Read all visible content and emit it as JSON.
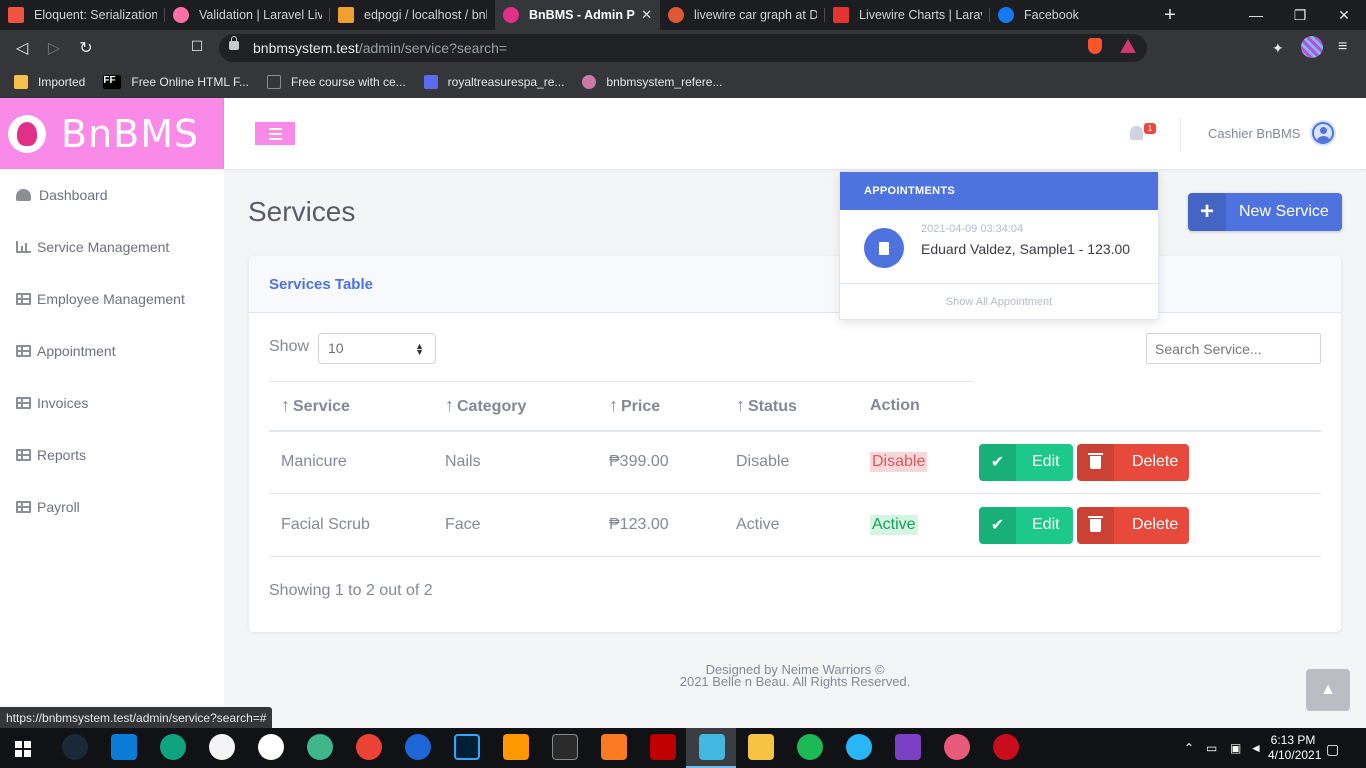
{
  "browser": {
    "tabs": [
      {
        "title": "Eloquent: Serialization -",
        "icon": "laravel-icon",
        "color": "#f05340",
        "active": false
      },
      {
        "title": "Validation | Laravel Livev",
        "icon": "livewire-icon",
        "color": "#fb70a9",
        "active": false
      },
      {
        "title": "edpogi / localhost / bnb",
        "icon": "phpmyadmin-icon",
        "color": "#f0a030",
        "active": false
      },
      {
        "title": "BnBMS - Admin Pa",
        "icon": "bnbms-icon",
        "color": "#e0308a",
        "active": true
      },
      {
        "title": "livewire car graph at Du",
        "icon": "duckduckgo-icon",
        "color": "#de5833",
        "active": false
      },
      {
        "title": "Livewire Charts | Laravel",
        "icon": "laravel-news-icon",
        "color": "#e3342f",
        "active": false
      },
      {
        "title": "Facebook",
        "icon": "facebook-icon",
        "color": "#1877f2",
        "active": false
      }
    ],
    "url_host": "bnbmsystem.test",
    "url_path": "/admin/service?search=",
    "bookmarks": [
      {
        "label": "Imported",
        "icon": "folder-icon",
        "color": "#f2c24a"
      },
      {
        "label": "Free Online HTML F...",
        "icon": "ff-icon",
        "color": "#ffffff"
      },
      {
        "label": "Free course with ce...",
        "icon": "rd-icon",
        "color": "#8a8b8f"
      },
      {
        "label": "royaltreasurespa_re...",
        "icon": "mail-icon",
        "color": "#5c6bf0"
      },
      {
        "label": "bnbmsystem_refere...",
        "icon": "pin-icon",
        "color": "#c77aa8"
      }
    ],
    "status_url": "https://bnbmsystem.test/admin/service?search=#"
  },
  "app": {
    "brand": "BnBMS",
    "notification_count": "1",
    "user": "Cashier BnBMS"
  },
  "sidebar": {
    "items": [
      {
        "label": "Dashboard",
        "icon": "tachometer-icon"
      },
      {
        "label": "Service Management",
        "icon": "chart-area-icon"
      },
      {
        "label": "Employee Management",
        "icon": "table-icon"
      },
      {
        "label": "Appointment",
        "icon": "table-icon"
      },
      {
        "label": "Invoices",
        "icon": "table-icon"
      },
      {
        "label": "Reports",
        "icon": "table-icon"
      },
      {
        "label": "Payroll",
        "icon": "table-icon"
      }
    ]
  },
  "page": {
    "title": "Services",
    "new_button": "New Service",
    "card_title": "Services Table",
    "show_label": "Show",
    "show_value": "10",
    "search_placeholder": "Search Service...",
    "columns": [
      "Service",
      "Category",
      "Price",
      "Status",
      "Action"
    ],
    "rows": [
      {
        "service": "Manicure",
        "category": "Nails",
        "price": "₱399.00",
        "status": "Disable",
        "action": "Disable"
      },
      {
        "service": "Facial Scrub",
        "category": "Face",
        "price": "₱123.00",
        "status": "Active",
        "action": "Active"
      }
    ],
    "edit_label": "Edit",
    "delete_label": "Delete",
    "showing": "Showing 1 to 2 out of 2"
  },
  "appointments_dropdown": {
    "header": "APPOINTMENTS",
    "items": [
      {
        "time": "2021-04-09 03:34:04",
        "text": "Eduard Valdez, Sample1 - 123.00"
      }
    ],
    "footer": "Show All Appointment"
  },
  "footer": {
    "line1": "Designed by Neime Warriors ©",
    "line2": "2021 Belle n Beau. All Rights Reserved."
  },
  "taskbar": {
    "time": "6:13 PM",
    "date": "4/10/2021"
  },
  "colors": {
    "brand_pink": "#f98ae8",
    "primary": "#4e73df",
    "success": "#1cc88a",
    "danger": "#e74a3b"
  }
}
